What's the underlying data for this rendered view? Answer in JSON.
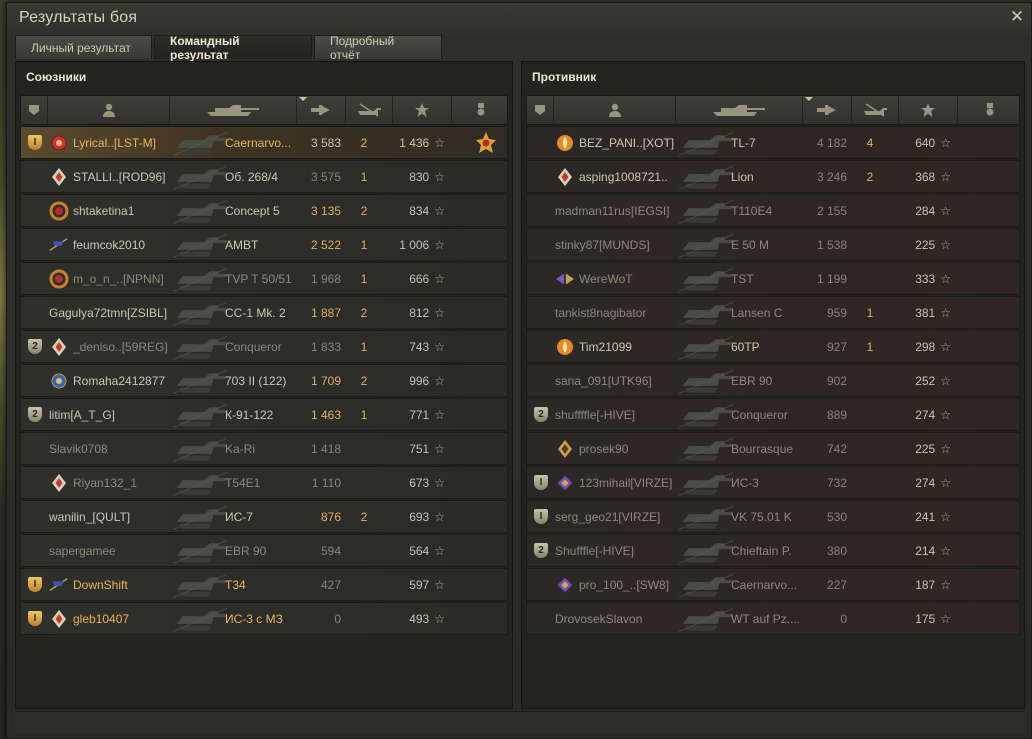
{
  "window": {
    "title": "Результаты боя",
    "close_icon": "close-icon"
  },
  "tabs": [
    {
      "label": "Личный результат",
      "active": false
    },
    {
      "label": "Командный результат",
      "active": true
    },
    {
      "label": "Подробный отчёт",
      "active": false
    }
  ],
  "allies": {
    "title": "Союзники",
    "rows": [
      {
        "squad": "I",
        "squad_gold": true,
        "badge": "medal-red",
        "player": "Lyrical..[LST-M]",
        "tank": "Caernarvo...",
        "damage": "3 583",
        "frags": "2",
        "xp": "1 436",
        "achievement": "order-medal-icon",
        "style": "gold"
      },
      {
        "squad": "",
        "badge": "rank-diamond",
        "player": "STALLI..[ROD96]",
        "tank": "Об. 268/4",
        "damage": "3 575",
        "frags": "1",
        "xp": "830",
        "style": "norm",
        "dmgstyle": "dim"
      },
      {
        "squad": "",
        "badge": "badge-laurel",
        "player": "shtaketina1",
        "tank": "Concept 5",
        "damage": "3 135",
        "frags": "2",
        "xp": "834",
        "style": "norm",
        "dmgstyle": "gold"
      },
      {
        "squad": "",
        "badge": "badge-flag",
        "player": "feumcok2010",
        "tank": "AMBT",
        "damage": "2 522",
        "frags": "1",
        "xp": "1 006",
        "style": "norm",
        "dmgstyle": "gold"
      },
      {
        "squad": "",
        "badge": "badge-laurel",
        "player": "m_o_n_..[NPNN]",
        "tank": "TVP T 50/51",
        "damage": "1 968",
        "frags": "1",
        "xp": "666",
        "style": "dim",
        "dmgstyle": "dim"
      },
      {
        "squad": "",
        "badge": "",
        "player": "Gagulya72tmn[ZSIBL]",
        "tank": "CC-1 Mk. 2",
        "damage": "1 887",
        "frags": "2",
        "xp": "812",
        "style": "norm",
        "dmgstyle": "gold"
      },
      {
        "squad": "2",
        "badge": "rank-diamond",
        "player": "_deniso..[59REG]",
        "tank": "Conqueror",
        "damage": "1 833",
        "frags": "1",
        "xp": "743",
        "style": "dim",
        "dmgstyle": "dim"
      },
      {
        "squad": "",
        "badge": "medal-blue",
        "player": "Romaha2412877",
        "tank": "703 II (122)",
        "damage": "1 709",
        "frags": "2",
        "xp": "996",
        "style": "norm",
        "dmgstyle": "gold"
      },
      {
        "squad": "2",
        "badge": "",
        "player": "litim[A_T_G]",
        "tank": "К-91-122",
        "damage": "1 463",
        "frags": "1",
        "xp": "771",
        "style": "norm",
        "dmgstyle": "gold"
      },
      {
        "squad": "",
        "badge": "",
        "player": "Slavik0708",
        "tank": "Ka-Ri",
        "damage": "1 418",
        "frags": "",
        "xp": "751",
        "style": "dim",
        "dmgstyle": "dim"
      },
      {
        "squad": "",
        "badge": "rank-diamond",
        "player": "Riyan132_1",
        "tank": "T54E1",
        "damage": "1 110",
        "frags": "",
        "xp": "673",
        "style": "dim",
        "dmgstyle": "dim"
      },
      {
        "squad": "",
        "badge": "",
        "player": "wanilin_[QULT]",
        "tank": "ИС-7",
        "damage": "876",
        "frags": "2",
        "xp": "693",
        "style": "norm",
        "dmgstyle": "gold"
      },
      {
        "squad": "",
        "badge": "",
        "player": "sapergamee",
        "tank": "EBR 90",
        "damage": "594",
        "frags": "",
        "xp": "564",
        "style": "dim",
        "dmgstyle": "dim"
      },
      {
        "squad": "I",
        "squad_gold": true,
        "badge": "badge-flag",
        "player": "DownShift",
        "tank": "T34",
        "damage": "427",
        "frags": "",
        "xp": "597",
        "style": "gold",
        "dmgstyle": "dim"
      },
      {
        "squad": "I",
        "squad_gold": true,
        "badge": "rank-diamond",
        "player": "gleb10407",
        "tank": "ИС-3 с МЗ",
        "damage": "0",
        "frags": "",
        "xp": "493",
        "style": "gold",
        "dmgstyle": "dim"
      }
    ]
  },
  "enemies": {
    "title": "Противник",
    "rows": [
      {
        "squad": "",
        "badge": "badge-flame",
        "player": "BEZ_PANI..[XOT]",
        "tank": "TL-7",
        "damage": "4 182",
        "frags": "4",
        "xp": "640",
        "style": "norm",
        "dmgstyle": "dim"
      },
      {
        "squad": "",
        "badge": "rank-diamond",
        "player": "asping1008721..",
        "tank": "Lion",
        "damage": "3 246",
        "frags": "2",
        "xp": "368",
        "style": "norm",
        "dmgstyle": "dim"
      },
      {
        "squad": "",
        "badge": "",
        "player": "madman11rus[IEGSI]",
        "tank": "T110E4",
        "damage": "2 155",
        "frags": "",
        "xp": "284",
        "style": "dim",
        "dmgstyle": "dim"
      },
      {
        "squad": "",
        "badge": "",
        "player": "stinky87[MUNDS]",
        "tank": "E 50 M",
        "damage": "1 538",
        "frags": "",
        "xp": "225",
        "style": "dim",
        "dmgstyle": "dim"
      },
      {
        "squad": "",
        "badge": "badge-wings",
        "player": "WereWoT",
        "tank": "TST",
        "damage": "1 199",
        "frags": "",
        "xp": "333",
        "style": "dim",
        "dmgstyle": "dim"
      },
      {
        "squad": "",
        "badge": "",
        "player": "tankist8nagibator",
        "tank": "Lansen C",
        "damage": "959",
        "frags": "1",
        "xp": "381",
        "style": "dim",
        "dmgstyle": "dim"
      },
      {
        "squad": "",
        "badge": "badge-flame",
        "player": "Tim21099",
        "tank": "60TP",
        "damage": "927",
        "frags": "1",
        "xp": "298",
        "style": "norm",
        "dmgstyle": "dim"
      },
      {
        "squad": "",
        "badge": "",
        "player": "sana_091[UTK96]",
        "tank": "EBR 90",
        "damage": "902",
        "frags": "",
        "xp": "252",
        "style": "dim",
        "dmgstyle": "dim"
      },
      {
        "squad": "2",
        "badge": "",
        "player": "shuffffle[-HIVE]",
        "tank": "Conqueror",
        "damage": "889",
        "frags": "",
        "xp": "274",
        "style": "dim",
        "dmgstyle": "dim"
      },
      {
        "squad": "",
        "badge": "rank-diamond-gold",
        "player": "prosek90",
        "tank": "Bourrasque",
        "damage": "742",
        "frags": "",
        "xp": "225",
        "style": "dim",
        "dmgstyle": "dim"
      },
      {
        "squad": "I",
        "badge": "badge-wings-purple",
        "player": "123mihail[VIRZE]",
        "tank": "ИС-3",
        "damage": "732",
        "frags": "",
        "xp": "274",
        "style": "dim",
        "dmgstyle": "dim"
      },
      {
        "squad": "I",
        "badge": "",
        "player": "serg_geo21[VIRZE]",
        "tank": "VK 75.01 K",
        "damage": "530",
        "frags": "",
        "xp": "241",
        "style": "dim",
        "dmgstyle": "dim"
      },
      {
        "squad": "2",
        "badge": "",
        "player": "Shufffle[-HIVE]",
        "tank": "Chieftain P.",
        "damage": "380",
        "frags": "",
        "xp": "214",
        "style": "dim",
        "dmgstyle": "dim"
      },
      {
        "squad": "",
        "badge": "badge-wings-purple",
        "player": "pro_100_..[SW8]",
        "tank": "Caernarvo...",
        "damage": "227",
        "frags": "",
        "xp": "187",
        "style": "dim",
        "dmgstyle": "dim"
      },
      {
        "squad": "",
        "badge": "",
        "player": "DrovosekSlavon",
        "tank": "WT auf Pz....",
        "damage": "0",
        "frags": "",
        "xp": "175",
        "style": "dim",
        "dmgstyle": "dim"
      }
    ]
  },
  "columns": [
    "squad-icon",
    "player-icon",
    "tank-icon",
    "damage-icon",
    "frags-icon",
    "xp-star-icon",
    "achievement-icon"
  ],
  "colors": {
    "gold_text": "#e9b35a",
    "normal_text": "#cdc7b1",
    "dim_text": "#8e897a",
    "frame": "#2a2a27"
  }
}
